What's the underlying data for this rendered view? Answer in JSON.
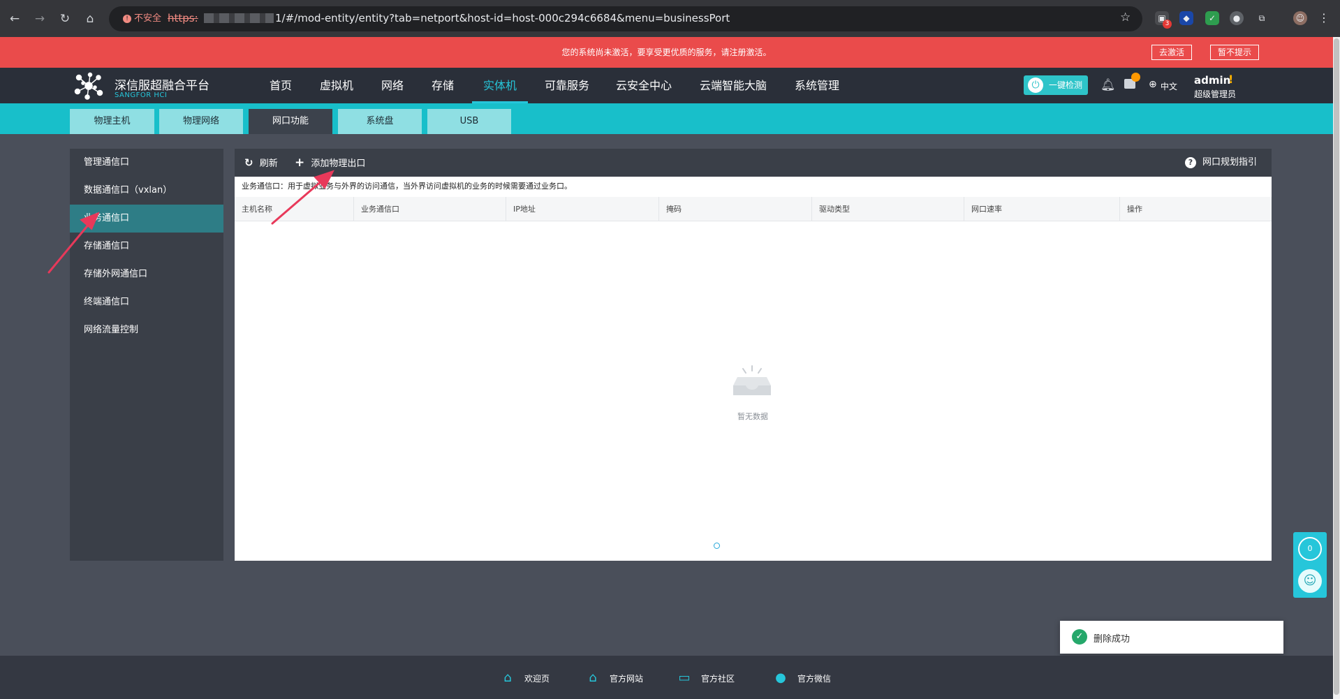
{
  "browser": {
    "security_label": "不安全",
    "url_scheme": "https:",
    "url_path": "1/#/mod-entity/entity?tab=netport&host-id=host-000c294c6684&menu=businessPort",
    "ext_badge": "3"
  },
  "banner": {
    "message": "您的系统尚未激活，要享受更优质的服务，请注册激活。",
    "activate_label": "去激活",
    "dismiss_label": "暂不提示"
  },
  "header": {
    "logo_title": "深信服超融合平台",
    "logo_subtitle": "SANGFOR HCI",
    "nav": [
      "首页",
      "虚拟机",
      "网络",
      "存储",
      "实体机",
      "可靠服务",
      "云安全中心",
      "云端智能大脑",
      "系统管理"
    ],
    "active_nav": "实体机",
    "check_label": "一键检测",
    "language": "中文",
    "user_name": "admin",
    "user_warn": "!",
    "user_role": "超级管理员"
  },
  "subtabs": [
    "物理主机",
    "物理网络",
    "网口功能",
    "系统盘",
    "USB"
  ],
  "active_subtab": "网口功能",
  "sidebar": {
    "items": [
      "管理通信口",
      "数据通信口（vxlan）",
      "业务通信口",
      "存储通信口",
      "存储外网通信口",
      "终端通信口",
      "网络流量控制"
    ],
    "active": "业务通信口"
  },
  "toolbar": {
    "refresh_label": "刷新",
    "add_label": "添加物理出口",
    "help_label": "网口规划指引"
  },
  "table": {
    "description": "业务通信口：用于虚拟业务与外界的访问通信，当外界访问虚拟机的业务的时候需要通过业务口。",
    "columns": [
      "主机名称",
      "业务通信口",
      "IP地址",
      "掩码",
      "驱动类型",
      "网口速率",
      "操作"
    ],
    "rows": [],
    "empty_text": "暂无数据"
  },
  "float_widget": {
    "count": "0"
  },
  "toast": {
    "message": "删除成功"
  },
  "footer": {
    "links": [
      "欢迎页",
      "官方网站",
      "官方社区",
      "官方微信"
    ]
  },
  "colors": {
    "accent": "#26c6da",
    "banner": "#ea4b4b",
    "header": "#2a2f39",
    "toast_success": "#25a86b"
  }
}
